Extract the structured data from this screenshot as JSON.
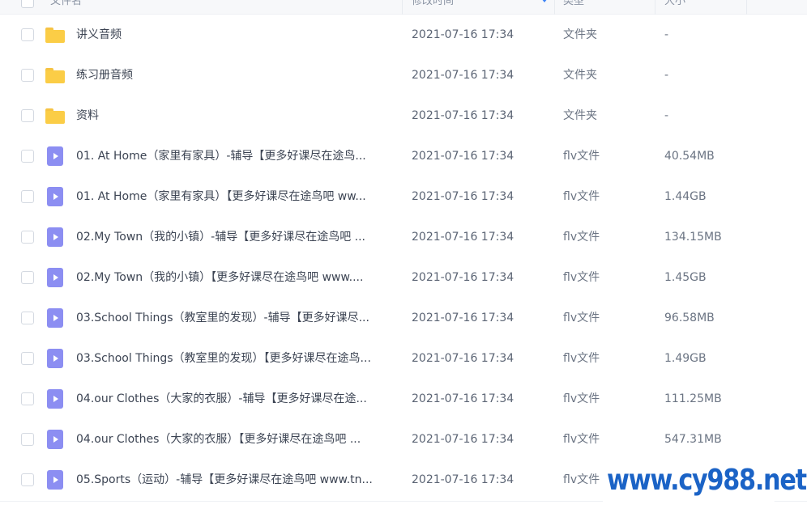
{
  "header": {
    "name_label": "文件名",
    "time_label": "修改时间",
    "type_label": "类型",
    "size_label": "大小"
  },
  "rows": [
    {
      "icon": "folder-icon",
      "name": "讲义音频",
      "time": "2021-07-16 17:34",
      "type": "文件夹",
      "size": "-"
    },
    {
      "icon": "folder-icon",
      "name": "练习册音频",
      "time": "2021-07-16 17:34",
      "type": "文件夹",
      "size": "-"
    },
    {
      "icon": "folder-icon",
      "name": "资料",
      "time": "2021-07-16 17:34",
      "type": "文件夹",
      "size": "-"
    },
    {
      "icon": "video-file-icon",
      "name": "01. At Home（家里有家具）-辅导【更多好课尽在途鸟...",
      "time": "2021-07-16 17:34",
      "type": "flv文件",
      "size": "40.54MB"
    },
    {
      "icon": "video-file-icon",
      "name": "01. At Home（家里有家具）【更多好课尽在途鸟吧 ww...",
      "time": "2021-07-16 17:34",
      "type": "flv文件",
      "size": "1.44GB"
    },
    {
      "icon": "video-file-icon",
      "name": "02.My Town（我的小镇）-辅导【更多好课尽在途鸟吧 ...",
      "time": "2021-07-16 17:34",
      "type": "flv文件",
      "size": "134.15MB"
    },
    {
      "icon": "video-file-icon",
      "name": "02.My Town（我的小镇）【更多好课尽在途鸟吧 www....",
      "time": "2021-07-16 17:34",
      "type": "flv文件",
      "size": "1.45GB"
    },
    {
      "icon": "video-file-icon",
      "name": "03.School Things（教室里的发现）-辅导【更多好课尽...",
      "time": "2021-07-16 17:34",
      "type": "flv文件",
      "size": "96.58MB"
    },
    {
      "icon": "video-file-icon",
      "name": "03.School Things（教室里的发现）【更多好课尽在途鸟...",
      "time": "2021-07-16 17:34",
      "type": "flv文件",
      "size": "1.49GB"
    },
    {
      "icon": "video-file-icon",
      "name": "04.our Clothes（大家的衣服）-辅导【更多好课尽在途...",
      "time": "2021-07-16 17:34",
      "type": "flv文件",
      "size": "111.25MB"
    },
    {
      "icon": "video-file-icon",
      "name": "04.our Clothes（大家的衣服）【更多好课尽在途鸟吧 ...",
      "time": "2021-07-16 17:34",
      "type": "flv文件",
      "size": "547.31MB"
    },
    {
      "icon": "video-file-icon",
      "name": "05.Sports（运动）-辅导【更多好课尽在途鸟吧 www.tn...",
      "time": "2021-07-16 17:34",
      "type": "flv文件",
      "size": ""
    }
  ],
  "watermark": "www.cy988.net",
  "colors": {
    "folder": "#fbcd46",
    "video_icon": "#8c8ef2",
    "sort_accent": "#3b82f6",
    "watermark": "#1b63c6"
  }
}
